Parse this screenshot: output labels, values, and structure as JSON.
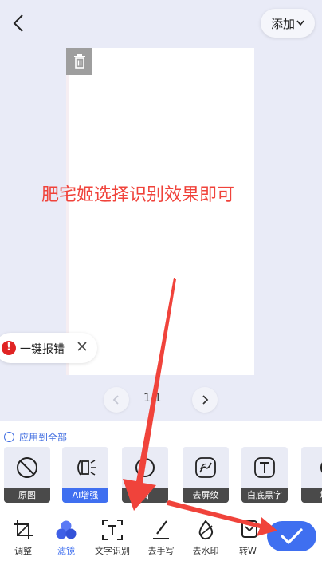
{
  "header": {
    "add_label": "添加"
  },
  "overlay": {
    "caption": "肥宅姬选择识别效果即可"
  },
  "report": {
    "label": "一键报错"
  },
  "pager": {
    "label": "1/1"
  },
  "apply_all": {
    "label": "应用到全部"
  },
  "filters": [
    {
      "label": "原图",
      "icon": "no-filter-icon",
      "active": false
    },
    {
      "label": "AI增强",
      "icon": "ai-enhance-icon",
      "active": true
    },
    {
      "label": "清",
      "icon": "sharpen-icon",
      "active": false
    },
    {
      "label": "去屏纹",
      "icon": "moire-icon",
      "active": false
    },
    {
      "label": "白底黑字",
      "icon": "text-t-icon",
      "active": false
    },
    {
      "label": "增",
      "icon": "enhance-icon",
      "active": false
    }
  ],
  "tools": [
    {
      "label": "调整",
      "icon": "crop-icon",
      "active": false
    },
    {
      "label": "滤镜",
      "icon": "filter-icon",
      "active": true
    },
    {
      "label": "文字识别",
      "icon": "ocr-icon",
      "active": false
    },
    {
      "label": "去手写",
      "icon": "pen-icon",
      "active": false
    },
    {
      "label": "去水印",
      "icon": "drop-icon",
      "active": false
    },
    {
      "label": "转W",
      "icon": "word-icon",
      "active": false
    }
  ],
  "colors": {
    "accent": "#3f6ff0",
    "annotation_red": "#f0433b",
    "background": "#e9ebf7"
  }
}
